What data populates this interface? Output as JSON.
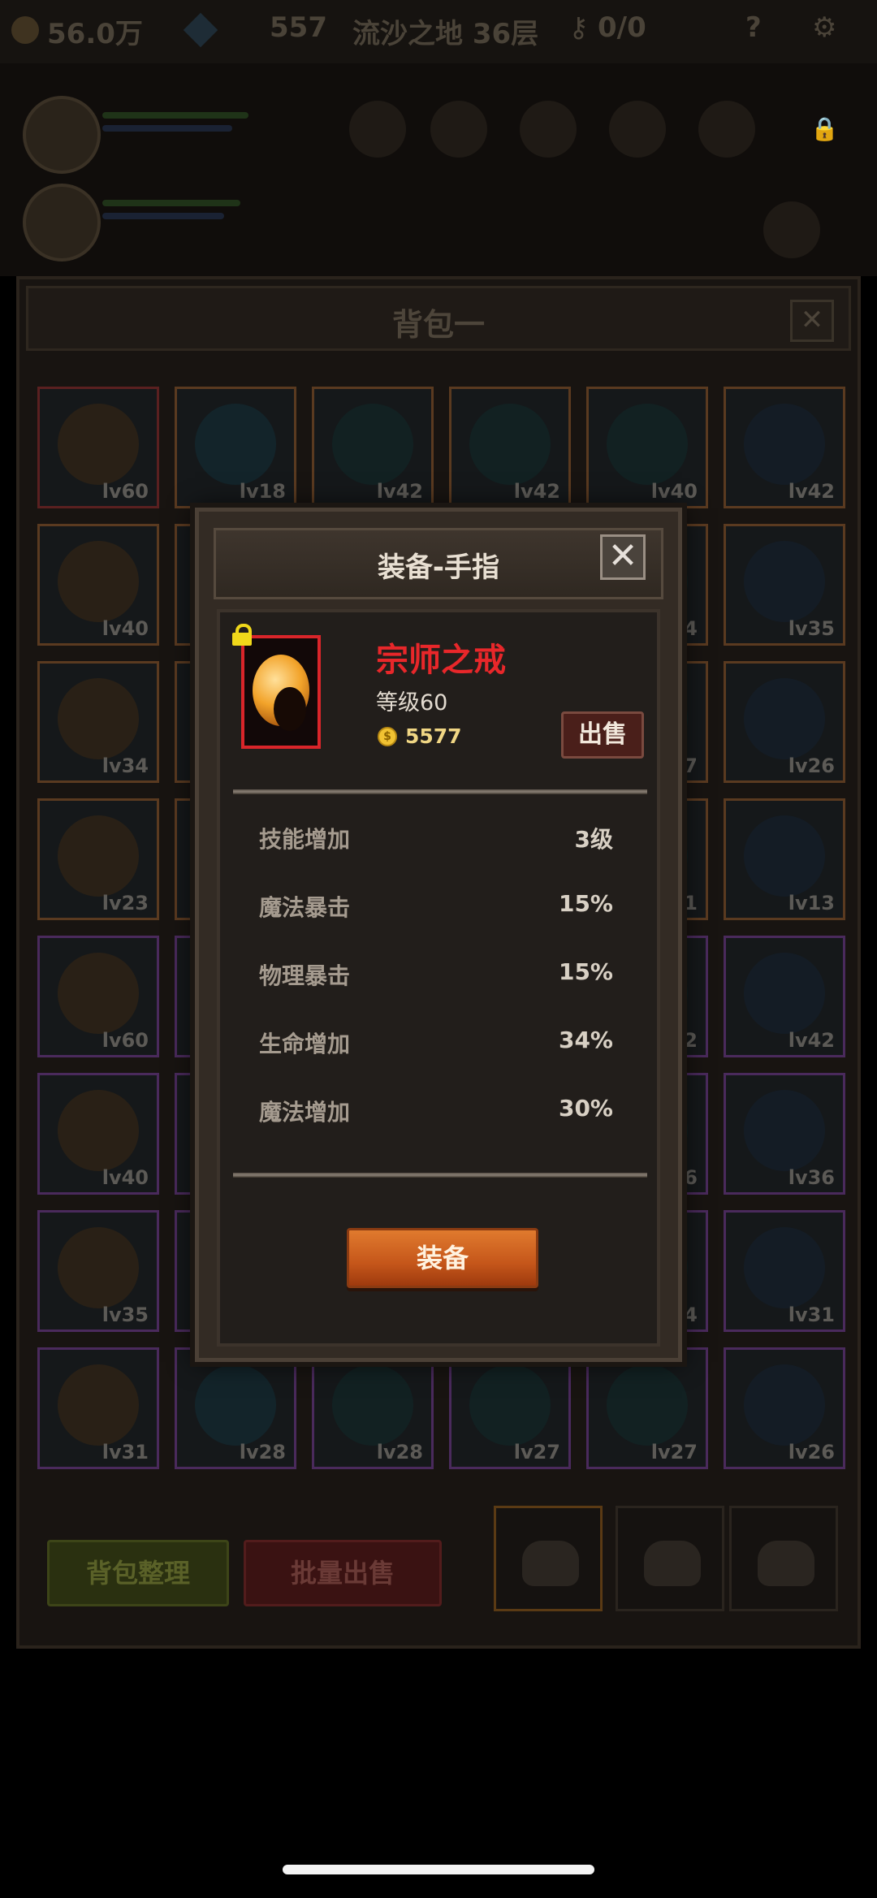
{
  "status_bar": {
    "gold": "56.0万",
    "gems": "557",
    "location": "流沙之地 36层",
    "keys": "0/0",
    "help_icon": "question-icon",
    "settings_icon": "gear-icon"
  },
  "bag": {
    "title": "背包一",
    "close_label": "✕",
    "slots": [
      {
        "lv": "lv60"
      },
      {
        "lv": "lv18"
      },
      {
        "lv": "lv42"
      },
      {
        "lv": "lv42"
      },
      {
        "lv": "lv40"
      },
      {
        "lv": "lv42"
      },
      {
        "lv": "lv40"
      },
      {
        "lv": ""
      },
      {
        "lv": ""
      },
      {
        "lv": ""
      },
      {
        "lv": "4"
      },
      {
        "lv": "lv35"
      },
      {
        "lv": "lv34"
      },
      {
        "lv": ""
      },
      {
        "lv": ""
      },
      {
        "lv": ""
      },
      {
        "lv": "7"
      },
      {
        "lv": "lv26"
      },
      {
        "lv": "lv23"
      },
      {
        "lv": ""
      },
      {
        "lv": ""
      },
      {
        "lv": ""
      },
      {
        "lv": "1"
      },
      {
        "lv": "lv13"
      },
      {
        "lv": "lv60"
      },
      {
        "lv": ""
      },
      {
        "lv": ""
      },
      {
        "lv": ""
      },
      {
        "lv": "2"
      },
      {
        "lv": "lv42"
      },
      {
        "lv": "lv40"
      },
      {
        "lv": ""
      },
      {
        "lv": ""
      },
      {
        "lv": ""
      },
      {
        "lv": "6"
      },
      {
        "lv": "lv36"
      },
      {
        "lv": "lv35"
      },
      {
        "lv": ""
      },
      {
        "lv": ""
      },
      {
        "lv": ""
      },
      {
        "lv": "4"
      },
      {
        "lv": "lv31"
      },
      {
        "lv": "lv31"
      },
      {
        "lv": "lv28"
      },
      {
        "lv": "lv28"
      },
      {
        "lv": "lv27"
      },
      {
        "lv": "lv27"
      },
      {
        "lv": "lv26"
      }
    ],
    "sort_label": "背包整理",
    "bulk_sell_label": "批量出售"
  },
  "dialog": {
    "title": "装备-手指",
    "close_label": "✕",
    "item_name": "宗师之戒",
    "item_level": "等级60",
    "coin_symbol": "$",
    "price": "5577",
    "sell_label": "出售",
    "stats": [
      {
        "key": "技能增加",
        "value": "3级"
      },
      {
        "key": "魔法暴击",
        "value": "15%"
      },
      {
        "key": "物理暴击",
        "value": "15%"
      },
      {
        "key": "生命增加",
        "value": "34%"
      },
      {
        "key": "魔法增加",
        "value": "30%"
      }
    ],
    "equip_label": "装备",
    "name_color": "#e8272a",
    "accent_color": "#c5561a"
  }
}
